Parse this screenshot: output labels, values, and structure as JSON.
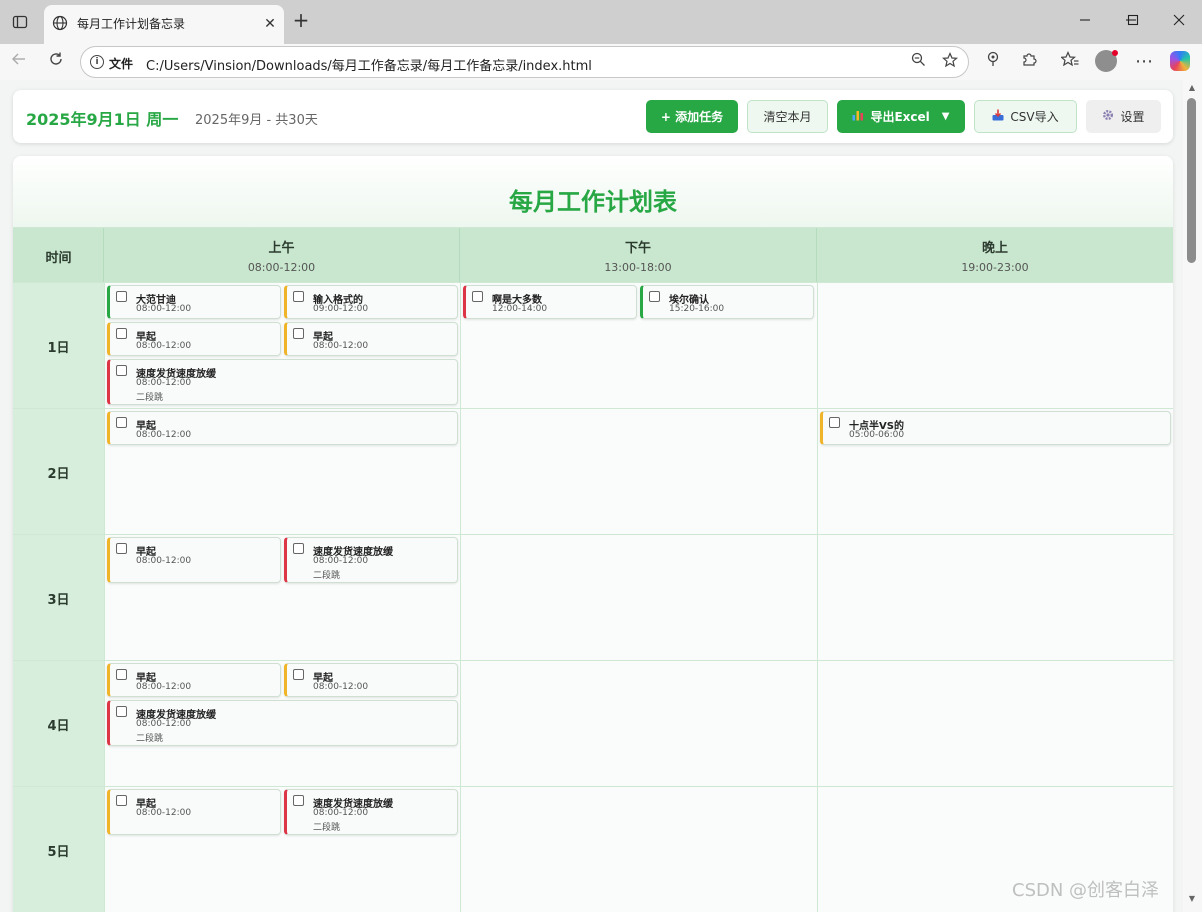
{
  "browser": {
    "tab_title": "每月工作计划备忘录",
    "tab_close": "✕",
    "new_tab": "+",
    "url_label": "文件",
    "url": "C:/Users/Vinsion/Downloads/每月工作备忘录/每月工作备忘录/index.html",
    "icons": [
      "sidebar-icon",
      "globe-icon",
      "back-icon",
      "refresh-icon",
      "info-icon",
      "zoom-icon",
      "star-icon",
      "extension-icon",
      "puzzle-icon",
      "favorites-icon",
      "profile-icon",
      "more-icon",
      "copilot-icon"
    ]
  },
  "header": {
    "date_title": "2025年9月1日 周一",
    "month_summary": "2025年9月 - 共30天",
    "add_task": "+ 添加任务",
    "clear_month": "清空本月",
    "export_excel": "导出Excel",
    "export_caret": "▼",
    "csv_import": "CSV导入",
    "settings": "设置"
  },
  "planner": {
    "title": "每月工作计划表",
    "time_header": "时间",
    "columns": [
      {
        "name": "上午",
        "range": "08:00-12:00"
      },
      {
        "name": "下午",
        "range": "13:00-18:00"
      },
      {
        "name": "晚上",
        "range": "19:00-23:00"
      }
    ],
    "days": [
      {
        "label": "1日",
        "morning": [
          {
            "title": "大范甘迪",
            "time": "08:00-12:00",
            "note": "",
            "color": "green"
          },
          {
            "title": "输入格式的",
            "time": "09:00-12:00",
            "note": "",
            "color": "yellow"
          },
          {
            "title": "早起",
            "time": "08:00-12:00",
            "note": "",
            "color": "yellow"
          },
          {
            "title": "早起",
            "time": "08:00-12:00",
            "note": "",
            "color": "yellow"
          },
          {
            "title": "速度发货速度放缓",
            "time": "08:00-12:00",
            "note": "二段跳",
            "color": "red"
          }
        ],
        "afternoon": [
          {
            "title": "啊是大多数",
            "time": "12:00-14:00",
            "note": "",
            "color": "red"
          },
          {
            "title": "埃尔确认",
            "time": "15:20-16:00",
            "note": "",
            "color": "green"
          }
        ],
        "evening": []
      },
      {
        "label": "2日",
        "morning": [
          {
            "title": "早起",
            "time": "08:00-12:00",
            "note": "",
            "color": "yellow"
          }
        ],
        "afternoon": [],
        "evening": [
          {
            "title": "十点半VS的",
            "time": "05:00-06:00",
            "note": "",
            "color": "yellow"
          }
        ]
      },
      {
        "label": "3日",
        "morning": [
          {
            "title": "早起",
            "time": "08:00-12:00",
            "note": "",
            "color": "yellow"
          },
          {
            "title": "速度发货速度放缓",
            "time": "08:00-12:00",
            "note": "二段跳",
            "color": "red"
          }
        ],
        "afternoon": [],
        "evening": []
      },
      {
        "label": "4日",
        "morning": [
          {
            "title": "早起",
            "time": "08:00-12:00",
            "note": "",
            "color": "yellow"
          },
          {
            "title": "早起",
            "time": "08:00-12:00",
            "note": "",
            "color": "yellow"
          },
          {
            "title": "速度发货速度放缓",
            "time": "08:00-12:00",
            "note": "二段跳",
            "color": "red"
          }
        ],
        "afternoon": [],
        "evening": []
      },
      {
        "label": "5日",
        "morning": [
          {
            "title": "早起",
            "time": "08:00-12:00",
            "note": "",
            "color": "yellow"
          },
          {
            "title": "速度发货速度放缓",
            "time": "08:00-12:00",
            "note": "二段跳",
            "color": "red"
          }
        ],
        "afternoon": [],
        "evening": []
      }
    ]
  },
  "colors": {
    "accent": "#28a745",
    "task_green": "#28a745",
    "task_yellow": "#f0b429",
    "task_red": "#dc3545"
  },
  "watermark": "CSDN @创客白泽"
}
